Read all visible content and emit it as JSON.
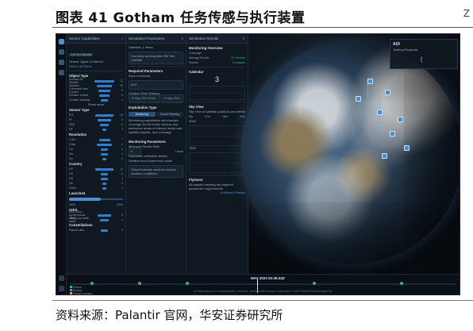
{
  "doc": {
    "title": "图表 41 Gotham 任务传感与执行装置",
    "edge_mark": "Z",
    "source": "资料来源：Palantir 官网，华安证券研究所"
  },
  "colors": {
    "accent": "#2f7fd0",
    "panel": "#101821",
    "background": "#0b1118",
    "timeline_green": "#3cb371"
  },
  "icons": [
    "home-icon",
    "filter-icon",
    "layers-icon",
    "settings-icon",
    "user-icon"
  ],
  "panel1": {
    "header": "Sensor Capabilities",
    "search_chip": "GM Test Satellite",
    "sensor_types": "Sensor Types of interest",
    "refine": "Refine All Filters",
    "object_type": {
      "title": "Object Type",
      "rows": [
        {
          "label": "Surface Air Models",
          "n": "12",
          "v": 0.9
        },
        {
          "label": "Airplane",
          "n": "10",
          "v": 0.7
        },
        {
          "label": "Command and Control",
          "n": "8",
          "v": 0.55
        },
        {
          "label": "Surface Vessel",
          "n": "6",
          "v": 0.45
        },
        {
          "label": "Surface Warship",
          "n": "4",
          "v": 0.3
        }
      ],
      "more": "Show more"
    },
    "sensor_type": {
      "title": "Sensor Type",
      "rows": [
        {
          "label": "EO",
          "n": "14",
          "v": 0.85
        },
        {
          "label": "IR",
          "n": "9",
          "v": 0.6
        },
        {
          "label": "SAR",
          "n": "6",
          "v": 0.4
        },
        {
          "label": "RF",
          "n": "3",
          "v": 0.2
        }
      ]
    },
    "resolution": {
      "title": "Resolution",
      "rows": [
        {
          "label": "0.3m",
          "n": "7",
          "v": 0.5
        },
        {
          "label": "0.5m",
          "n": "9",
          "v": 0.65
        },
        {
          "label": "1m",
          "n": "5",
          "v": 0.35
        },
        {
          "label": "3m",
          "n": "4",
          "v": 0.3
        },
        {
          "label": "5m",
          "n": "2",
          "v": 0.15
        }
      ]
    },
    "country": {
      "title": "Country",
      "rows": [
        {
          "label": "US",
          "n": "11",
          "v": 0.8
        },
        {
          "label": "UK",
          "n": "5",
          "v": 0.35
        },
        {
          "label": "FR",
          "n": "4",
          "v": 0.3
        },
        {
          "label": "DE",
          "n": "3",
          "v": 0.2
        },
        {
          "label": "Other",
          "n": "2",
          "v": 0.15
        }
      ]
    },
    "launched": {
      "title": "Launched",
      "from": "2000",
      "to": "2024"
    },
    "orbit": {
      "title": "Orbit",
      "rows": [
        {
          "label": "SSO (Sun-synchronous orbit)",
          "n": "9",
          "v": 0.6
        },
        {
          "label": "LEO (Low earth orbit)",
          "n": "6",
          "v": 0.4
        }
      ]
    },
    "constellation": {
      "title": "Constellations",
      "rows": [
        {
          "label": "Planet Labs",
          "n": "4",
          "v": 0.3
        }
      ]
    }
  },
  "panel2": {
    "header": "Simulation Parameters",
    "sub": "Satellites 1 Items",
    "note": "Currently working with GM Test Satellite",
    "required": "Required Parameters",
    "area": "Area of Interest",
    "area_value": "AOI",
    "window": "Window Time Window",
    "window_from": "12 May 2024 00:00",
    "window_to": "24 May 2024",
    "exploitation": "Exploitation Type",
    "tab_a": "Monitoring",
    "tab_b": "Broad Planning",
    "exp_desc": "Monitoring exploitation will simulate coverage for the entire window and determine areas of interest revisit rate, satellite passes, and coverage.",
    "monitoring": "Monitoring Parameters",
    "min_revisit": "Minimum Revisit Rate",
    "revisit_value": "6",
    "revisit_unit": "Hours",
    "param_def": "Parameter Definition Model",
    "weather": "Weather and Ephemeral model",
    "weather_desc": "Select forecast model to include weather conditions",
    "simulate": "Simulate"
  },
  "panel3": {
    "header": "Simulation Results",
    "overview": "Monitoring Overview",
    "coverage": "Coverage",
    "avg_revisit": "Average Revisit",
    "avg_revisit_value": "22 minutes",
    "passes": "Passes",
    "passes_value": "15 passes",
    "calendar": "Calendar",
    "big_value": "3",
    "sky_view": "Sky View",
    "sky_note": "Sky view of satellite positions and elevation",
    "axis_a": "6hr",
    "axis_b": "12hr",
    "axis_c": "18hr",
    "axis_d": "24hr",
    "val_hi": "3000",
    "val_lo": "1500",
    "flyovers": "Flyovers",
    "fly_note": "All passes meeting the required parameter requirements",
    "link": "Unfiltered Passes"
  },
  "map": {
    "aoi_title": "AOI",
    "tasking": "Tasking Requests",
    "spinner": "(",
    "timeline_label": "MAY 2024 02:45:44Z",
    "legend_a": "Passes",
    "legend_b": "Revisits",
    "legend_c": "Overall coverage",
    "footer": "All data shown is a representative, notional, and fictional scenario. Copyright © 2024 Palantir Technologies Inc."
  }
}
